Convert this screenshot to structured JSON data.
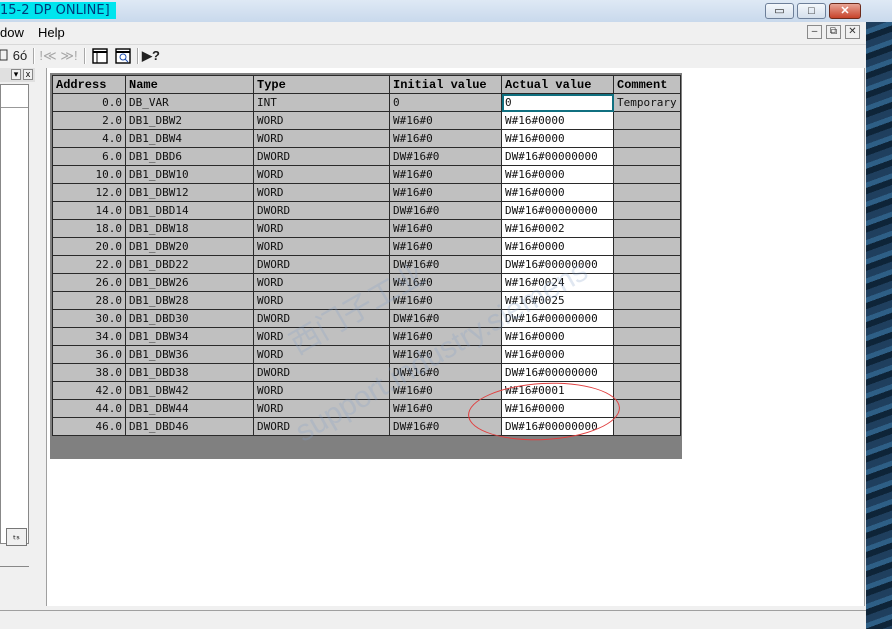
{
  "window": {
    "title_fragment": "15-2 DP  ONLINE]",
    "btn_min": "▭",
    "btn_max": "□",
    "btn_close": "✕"
  },
  "menu": {
    "items": [
      "dow",
      "Help"
    ],
    "mdi_min": "–",
    "mdi_restore": "⧉",
    "mdi_close": "✕"
  },
  "toolbar": {
    "glasses": "6ó",
    "prev": "!≪",
    "next": "≫!",
    "help": "▶?"
  },
  "left_panel": {
    "tool_label": "ₜₛ"
  },
  "table": {
    "headers": [
      "Address",
      "Name",
      "Type",
      "Initial value",
      "Actual value",
      "Comment"
    ],
    "rows": [
      [
        "0.0",
        "DB_VAR",
        "INT",
        "0",
        "0",
        "Temporary"
      ],
      [
        "2.0",
        "DB1_DBW2",
        "WORD",
        "W#16#0",
        "W#16#0000",
        ""
      ],
      [
        "4.0",
        "DB1_DBW4",
        "WORD",
        "W#16#0",
        "W#16#0000",
        ""
      ],
      [
        "6.0",
        "DB1_DBD6",
        "DWORD",
        "DW#16#0",
        "DW#16#00000000",
        ""
      ],
      [
        "10.0",
        "DB1_DBW10",
        "WORD",
        "W#16#0",
        "W#16#0000",
        ""
      ],
      [
        "12.0",
        "DB1_DBW12",
        "WORD",
        "W#16#0",
        "W#16#0000",
        ""
      ],
      [
        "14.0",
        "DB1_DBD14",
        "DWORD",
        "DW#16#0",
        "DW#16#00000000",
        ""
      ],
      [
        "18.0",
        "DB1_DBW18",
        "WORD",
        "W#16#0",
        "W#16#0002",
        ""
      ],
      [
        "20.0",
        "DB1_DBW20",
        "WORD",
        "W#16#0",
        "W#16#0000",
        ""
      ],
      [
        "22.0",
        "DB1_DBD22",
        "DWORD",
        "DW#16#0",
        "DW#16#00000000",
        ""
      ],
      [
        "26.0",
        "DB1_DBW26",
        "WORD",
        "W#16#0",
        "W#16#0024",
        ""
      ],
      [
        "28.0",
        "DB1_DBW28",
        "WORD",
        "W#16#0",
        "W#16#0025",
        ""
      ],
      [
        "30.0",
        "DB1_DBD30",
        "DWORD",
        "DW#16#0",
        "DW#16#00000000",
        ""
      ],
      [
        "34.0",
        "DB1_DBW34",
        "WORD",
        "W#16#0",
        "W#16#0000",
        ""
      ],
      [
        "36.0",
        "DB1_DBW36",
        "WORD",
        "W#16#0",
        "W#16#0000",
        ""
      ],
      [
        "38.0",
        "DB1_DBD38",
        "DWORD",
        "DW#16#0",
        "DW#16#00000000",
        ""
      ],
      [
        "42.0",
        "DB1_DBW42",
        "WORD",
        "W#16#0",
        "W#16#0001",
        ""
      ],
      [
        "44.0",
        "DB1_DBW44",
        "WORD",
        "W#16#0",
        "W#16#0000",
        ""
      ],
      [
        "46.0",
        "DB1_DBD46",
        "DWORD",
        "DW#16#0",
        "DW#16#00000000",
        ""
      ]
    ]
  },
  "watermark": {
    "line1": "西门子工业",
    "line2": "support.industry.siemens"
  }
}
